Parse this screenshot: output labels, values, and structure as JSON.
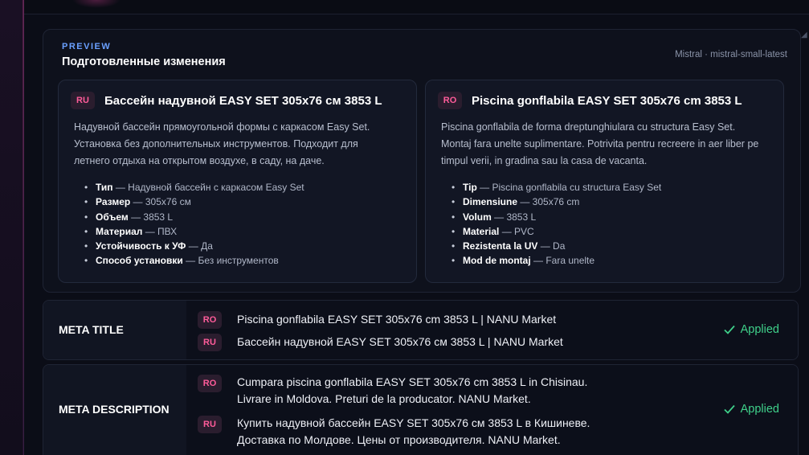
{
  "preview": {
    "label": "PREVIEW",
    "title": "Подготовленные изменения",
    "model": "Mistral · mistral-small-latest"
  },
  "cards": {
    "ru": {
      "badge": "RU",
      "title": "Бассейн надувной EASY SET 305x76 см 3853 L",
      "description": "Надувной бассейн прямоугольной формы с каркасом Easy Set. Установка без дополнительных инструментов. Подходит для летнего отдыха на открытом воздухе, в саду, на даче.",
      "attributes": [
        {
          "name": "Тип",
          "value": " — Надувной бассейн с каркасом Easy Set"
        },
        {
          "name": "Размер",
          "value": " — 305x76 см"
        },
        {
          "name": "Объем",
          "value": " — 3853 L"
        },
        {
          "name": "Материал",
          "value": " — ПВХ"
        },
        {
          "name": "Устойчивость к УФ",
          "value": " — Да"
        },
        {
          "name": "Способ установки",
          "value": " — Без инструментов"
        }
      ]
    },
    "ro": {
      "badge": "RO",
      "title": "Piscina gonflabila EASY SET 305x76 cm 3853 L",
      "description": "Piscina gonflabila de forma dreptunghiulara cu structura Easy Set. Montaj fara unelte suplimentare. Potrivita pentru recreere in aer liber pe timpul verii, in gradina sau la casa de vacanta.",
      "attributes": [
        {
          "name": "Tip",
          "value": " — Piscina gonflabila cu structura Easy Set"
        },
        {
          "name": "Dimensiune",
          "value": " — 305x76 cm"
        },
        {
          "name": "Volum",
          "value": " — 3853 L"
        },
        {
          "name": "Material",
          "value": " — PVC"
        },
        {
          "name": "Rezistenta la UV",
          "value": " — Da"
        },
        {
          "name": "Mod de montaj",
          "value": " — Fara unelte"
        }
      ]
    }
  },
  "meta_title": {
    "label": "META TITLE",
    "ro_badge": "RO",
    "ro_text": "Piscina gonflabila EASY SET 305x76 cm 3853 L | NANU Market",
    "ru_badge": "RU",
    "ru_text": "Бассейн надувной EASY SET 305x76 см 3853 L | NANU Market",
    "status": "Applied"
  },
  "meta_description": {
    "label": "META DESCRIPTION",
    "ro_badge": "RO",
    "ro_line1": "Cumpara piscina gonflabila EASY SET 305x76 cm 3853 L in Chisinau.",
    "ro_line2": "Livrare in Moldova. Preturi de la producator. NANU Market.",
    "ru_badge": "RU",
    "ru_line1": "Купить надувной бассейн EASY SET 305x76 см 3853 L в Кишиневе.",
    "ru_line2": "Доставка по Молдове. Цены от производителя. NANU Market.",
    "status": "Applied"
  },
  "colors": {
    "accent_badge": "#ff5c9a",
    "applied": "#3fd08a",
    "preview_label": "#6aa0ff"
  },
  "icons": {
    "applied": "check-icon"
  }
}
